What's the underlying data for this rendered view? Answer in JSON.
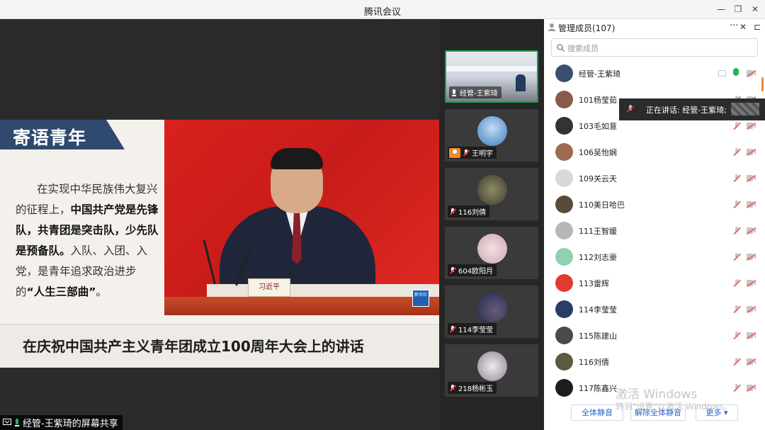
{
  "window": {
    "title": "腾讯会议",
    "minimize": "—",
    "restore": "❐",
    "close": "✕"
  },
  "share": {
    "slide": {
      "banner": "寄语青年",
      "text_plain_1": "在实现中华民族伟大复兴的征程上，",
      "text_bold_1": "中国共产党是先锋队，共青团是突击队，少先队是预备队。",
      "text_plain_2": "入队、入团、入党，是青年追求政治进步的",
      "text_bold_2": "“人生三部曲”",
      "text_plain_3": "。",
      "nameplate": "习近平",
      "logo_text": "新华社",
      "caption": "在庆祝中国共产主义青年团成立100周年大会上的讲话"
    },
    "label": "经管-王紫琦的屏幕共享"
  },
  "videos": [
    {
      "name": "经管-王紫琦",
      "active": true,
      "mic": "on"
    },
    {
      "name": "王明宇",
      "active": false,
      "mic": "muted",
      "avatar_color": "#5a8fc6"
    },
    {
      "name": "116刘倩",
      "active": false,
      "mic": "muted",
      "avatar_color": "#6e6a4e"
    },
    {
      "name": "604欧阳月",
      "active": false,
      "mic": "muted",
      "avatar_color": "#e8c5c8"
    },
    {
      "name": "114李莹莹",
      "active": false,
      "mic": "muted",
      "avatar_color": "#2a3d66"
    },
    {
      "name": "218杨彬玉",
      "active": false,
      "mic": "muted",
      "avatar_color": "#c9c0c8"
    }
  ],
  "panel": {
    "title": "管理成员(107)",
    "more": "···",
    "close": "✕",
    "collapse": "⊏",
    "search_placeholder": "搜索成员",
    "members": [
      {
        "name": "经管-王紫琦",
        "color": "#3c4f6e",
        "speaking": true
      },
      {
        "name": "101杨莹茹",
        "color": "#8a5a4a"
      },
      {
        "name": "103毛如意",
        "color": "#333333"
      },
      {
        "name": "106吴怡娴",
        "color": "#9c6b52"
      },
      {
        "name": "109关云天",
        "color": "#d8d8d8"
      },
      {
        "name": "110美日哈巴",
        "color": "#5a4a3a"
      },
      {
        "name": "111王智媛",
        "color": "#b7b7b7"
      },
      {
        "name": "112刘志豪",
        "color": "#8fd1b0"
      },
      {
        "name": "113雷辉",
        "color": "#e23b2e"
      },
      {
        "name": "114李莹莹",
        "color": "#2a3d66"
      },
      {
        "name": "115陈建山",
        "color": "#4a4a4a"
      },
      {
        "name": "116刘倩",
        "color": "#5e5a40"
      },
      {
        "name": "117陈鑫兴",
        "color": "#1d1d1d"
      }
    ],
    "speaking_tip": "正在讲话: 经管-王紫琦;",
    "buttons": {
      "mute_all": "全体静音",
      "unmute_all": "解除全体静音",
      "more": "更多 ▾"
    }
  },
  "watermark": {
    "line1": "激活 Windows",
    "line2": "转到\"设置\"以激活 Windows。"
  }
}
